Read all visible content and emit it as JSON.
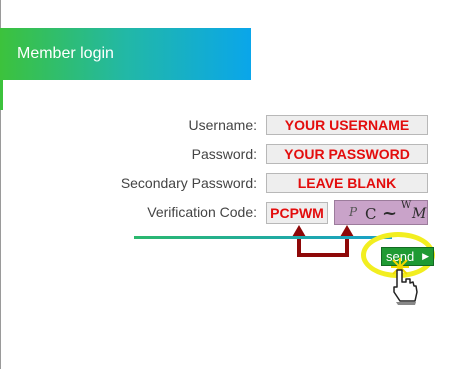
{
  "header": {
    "title": "Member login"
  },
  "form": {
    "username_label": "Username:",
    "username_value": "YOUR USERNAME",
    "password_label": "Password:",
    "password_value": "YOUR PASSWORD",
    "secondary_label": "Secondary Password:",
    "secondary_value": "LEAVE BLANK",
    "verification_label": "Verification Code:",
    "verification_value": "PCPWM",
    "captcha_chars": [
      "P",
      "C",
      "~",
      "W",
      "M"
    ]
  },
  "actions": {
    "send_label": "send",
    "send_icon": "play-triangle-icon"
  },
  "colors": {
    "header_start": "#3cc23c",
    "header_end": "#0aa6ea",
    "annotation_red": "#e30d0d",
    "highlight_yellow": "#f2ee20",
    "button_green": "#1f9a33",
    "captcha_bg": "#c9a3c9"
  }
}
